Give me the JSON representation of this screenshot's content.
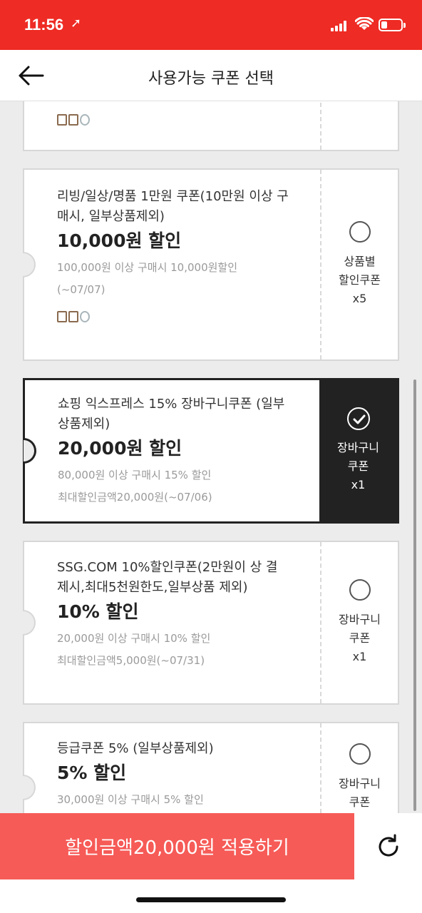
{
  "status_bar": {
    "time": "11:56",
    "location_glyph": "➚"
  },
  "header": {
    "back_icon": "arrow-left-icon",
    "title": "사용가능 쿠폰 선택"
  },
  "coupons": [
    {
      "name": "",
      "amount": "",
      "conditions": [],
      "type_lines": [],
      "selected": false
    },
    {
      "name": "리빙/일상/명품 1만원 쿠폰(10만원 이상 구매시, 일부상품제외)",
      "amount": "10,000원 할인",
      "conditions": [
        "100,000원 이상 구매시 10,000원할인",
        "(~07/07)"
      ],
      "type_lines": [
        "상품별",
        "할인쿠폰",
        "x5"
      ],
      "selected": false
    },
    {
      "name": "쇼핑 익스프레스 15% 장바구니쿠폰 (일부상품제외)",
      "amount": "20,000원 할인",
      "conditions": [
        "80,000원 이상 구매시 15% 할인",
        "최대할인금액20,000원(~07/06)"
      ],
      "type_lines": [
        "장바구니",
        "쿠폰",
        "x1"
      ],
      "selected": true
    },
    {
      "name": "SSG.COM 10%할인쿠폰(2만원이 상 결제시,최대5천원한도,일부상품 제외)",
      "amount": "10% 할인",
      "conditions": [
        "20,000원 이상 구매시 10% 할인",
        "최대할인금액5,000원(~07/31)"
      ],
      "type_lines": [
        "장바구니",
        "쿠폰",
        "x1"
      ],
      "selected": false
    },
    {
      "name": "등급쿠폰 5% (일부상품제외)",
      "amount": "5% 할인",
      "conditions": [
        "30,000원 이상 구매시 5% 할인"
      ],
      "type_lines": [
        "장바구니",
        "쿠폰"
      ],
      "selected": false
    }
  ],
  "apply_button": {
    "label": "할인금액20,000원 적용하기"
  },
  "refresh_icon": "refresh-icon",
  "colors": {
    "brand_red": "#ee2b24",
    "apply_bg": "#f65b57",
    "selected_bg": "#222222"
  }
}
